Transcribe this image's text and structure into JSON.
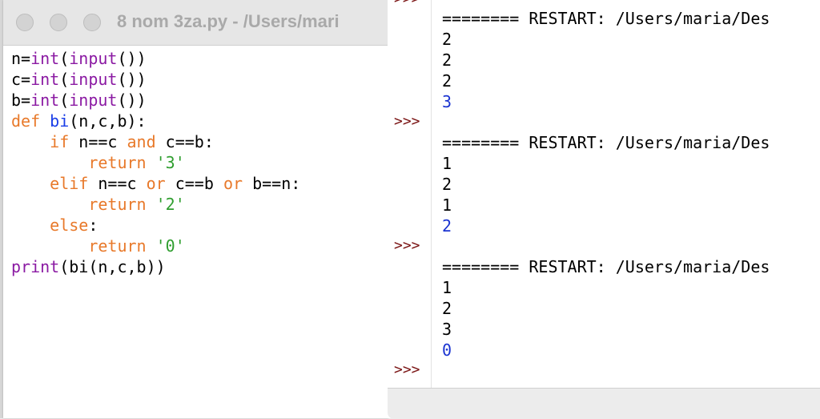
{
  "editor": {
    "title": "8 nom 3za.py - /Users/mari",
    "code_lines": [
      [
        {
          "t": "n=",
          "c": ""
        },
        {
          "t": "int",
          "c": "bi"
        },
        {
          "t": "(",
          "c": ""
        },
        {
          "t": "input",
          "c": "bi"
        },
        {
          "t": "())",
          "c": ""
        }
      ],
      [
        {
          "t": "c=",
          "c": ""
        },
        {
          "t": "int",
          "c": "bi"
        },
        {
          "t": "(",
          "c": ""
        },
        {
          "t": "input",
          "c": "bi"
        },
        {
          "t": "())",
          "c": ""
        }
      ],
      [
        {
          "t": "b=",
          "c": ""
        },
        {
          "t": "int",
          "c": "bi"
        },
        {
          "t": "(",
          "c": ""
        },
        {
          "t": "input",
          "c": "bi"
        },
        {
          "t": "())",
          "c": ""
        }
      ],
      [
        {
          "t": "def",
          "c": "kw"
        },
        {
          "t": " ",
          "c": ""
        },
        {
          "t": "bi",
          "c": "df"
        },
        {
          "t": "(n,c,b):",
          "c": ""
        }
      ],
      [
        {
          "t": "    ",
          "c": ""
        },
        {
          "t": "if",
          "c": "kw"
        },
        {
          "t": " n==c ",
          "c": ""
        },
        {
          "t": "and",
          "c": "kw"
        },
        {
          "t": " c==b:",
          "c": ""
        }
      ],
      [
        {
          "t": "        ",
          "c": ""
        },
        {
          "t": "return",
          "c": "kw"
        },
        {
          "t": " ",
          "c": ""
        },
        {
          "t": "'3'",
          "c": "st"
        }
      ],
      [
        {
          "t": "    ",
          "c": ""
        },
        {
          "t": "elif",
          "c": "kw"
        },
        {
          "t": " n==c ",
          "c": ""
        },
        {
          "t": "or",
          "c": "kw"
        },
        {
          "t": " c==b ",
          "c": ""
        },
        {
          "t": "or",
          "c": "kw"
        },
        {
          "t": " b==n:",
          "c": ""
        }
      ],
      [
        {
          "t": "        ",
          "c": ""
        },
        {
          "t": "return",
          "c": "kw"
        },
        {
          "t": " ",
          "c": ""
        },
        {
          "t": "'2'",
          "c": "st"
        }
      ],
      [
        {
          "t": "    ",
          "c": ""
        },
        {
          "t": "else",
          "c": "kw"
        },
        {
          "t": ":",
          "c": ""
        }
      ],
      [
        {
          "t": "        ",
          "c": ""
        },
        {
          "t": "return",
          "c": "kw"
        },
        {
          "t": " ",
          "c": ""
        },
        {
          "t": "'0'",
          "c": "st"
        }
      ],
      [
        {
          "t": "print",
          "c": "bi"
        },
        {
          "t": "(bi(n,c,b))",
          "c": ""
        }
      ]
    ]
  },
  "shell": {
    "top_prompt": ">>>",
    "runs": [
      {
        "restart": "======== RESTART: /Users/maria/Des",
        "inputs": [
          "2",
          "2",
          "2"
        ],
        "result": "3",
        "prompt": ">>>"
      },
      {
        "restart": "======== RESTART: /Users/maria/Des",
        "inputs": [
          "1",
          "2",
          "1"
        ],
        "result": "2",
        "prompt": ">>>"
      },
      {
        "restart": "======== RESTART: /Users/maria/Des",
        "inputs": [
          "1",
          "2",
          "3"
        ],
        "result": "0",
        "prompt": ">>>"
      }
    ]
  },
  "colors": {
    "keyword": "#e8792a",
    "builtin": "#8b1aa3",
    "def_name": "#1a3ee8",
    "string": "#2f9e2f",
    "result": "#1a33d1",
    "prompt": "#7a1313"
  }
}
